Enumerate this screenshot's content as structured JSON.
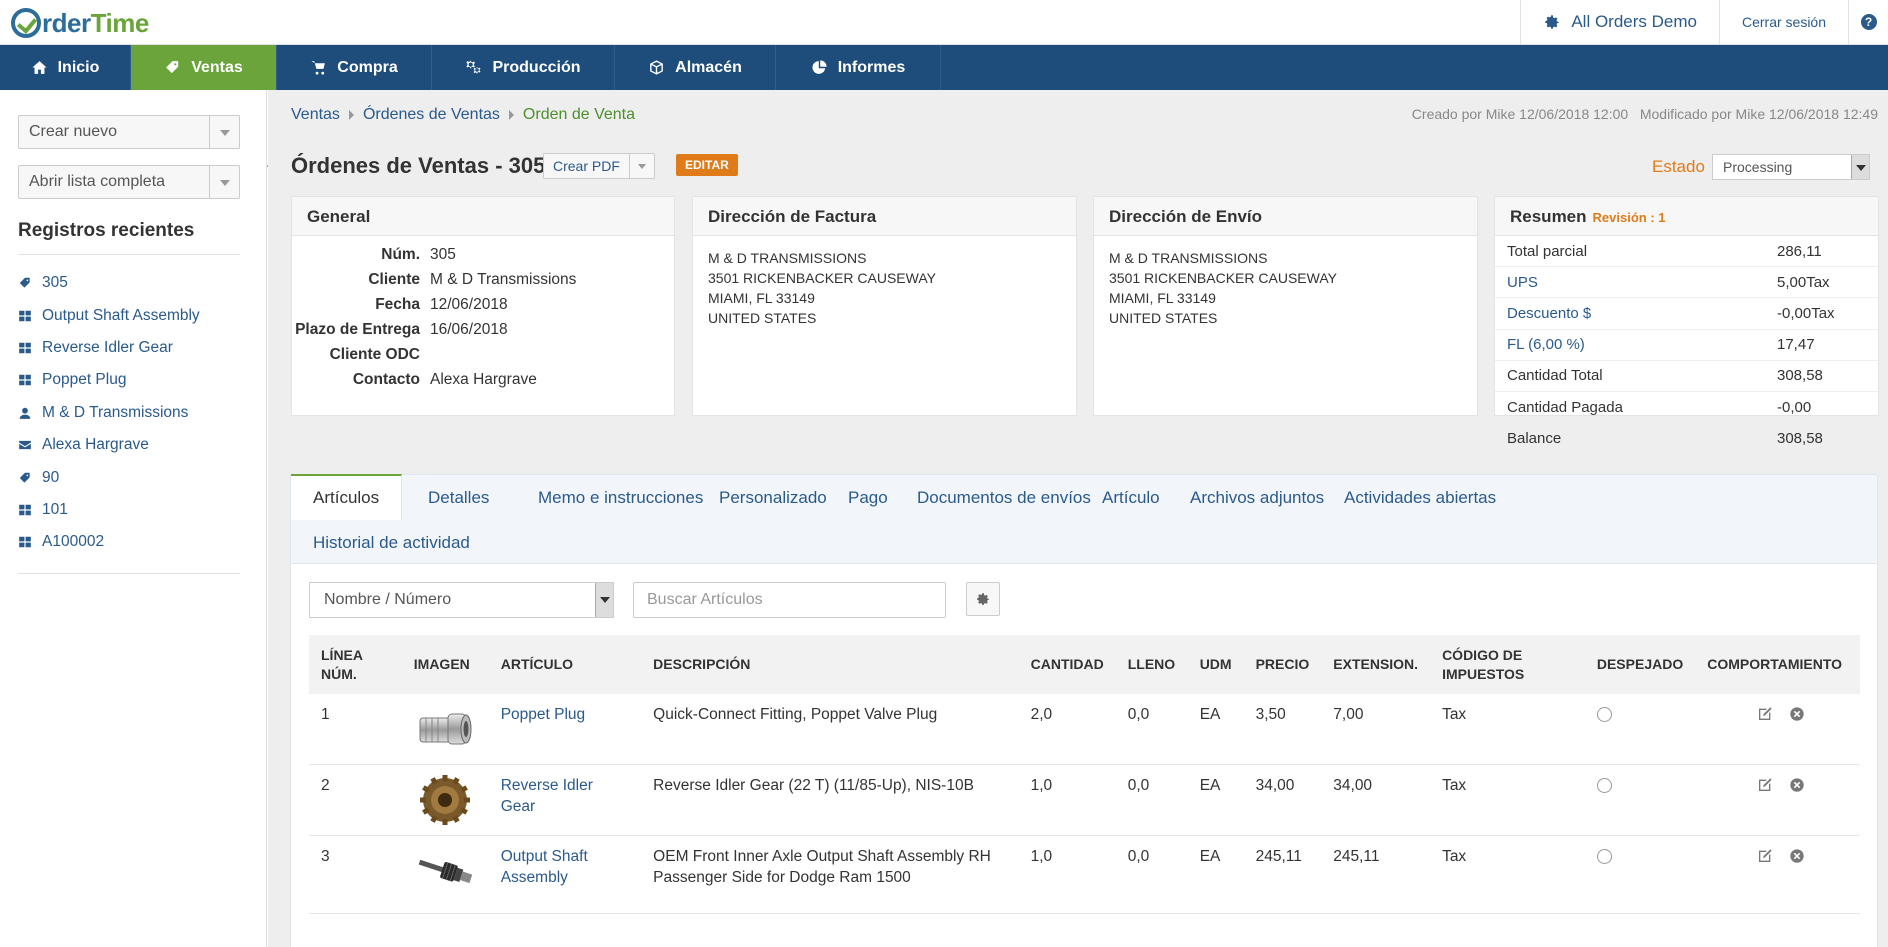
{
  "app": {
    "logo_text_a": "rder",
    "logo_text_b": "Time",
    "company": "All Orders Demo",
    "logout": "Cerrar sesión",
    "help": "?"
  },
  "nav": [
    {
      "label": "Inicio",
      "icon": "home-icon"
    },
    {
      "label": "Ventas",
      "icon": "tag-icon",
      "active": true
    },
    {
      "label": "Compra",
      "icon": "cart-icon"
    },
    {
      "label": "Producción",
      "icon": "gears-icon"
    },
    {
      "label": "Almacén",
      "icon": "box-icon"
    },
    {
      "label": "Informes",
      "icon": "pie-chart-icon"
    }
  ],
  "sidebar": {
    "create_new": "Crear nuevo",
    "open_list": "Abrir lista completa",
    "recent_title": "Registros recientes",
    "recent": [
      {
        "label": "305",
        "icon": "tag-icon"
      },
      {
        "label": "Output Shaft Assembly",
        "icon": "grid-icon"
      },
      {
        "label": "Reverse Idler Gear",
        "icon": "grid-icon"
      },
      {
        "label": "Poppet Plug",
        "icon": "grid-icon"
      },
      {
        "label": "M & D Transmissions",
        "icon": "user-icon"
      },
      {
        "label": "Alexa Hargrave",
        "icon": "envelope-icon"
      },
      {
        "label": "90",
        "icon": "tag-icon"
      },
      {
        "label": "101",
        "icon": "grid-icon"
      },
      {
        "label": "A100002",
        "icon": "grid-icon"
      }
    ]
  },
  "breadcrumb": [
    "Ventas",
    "Órdenes de Ventas",
    "Orden de Venta"
  ],
  "meta": "Creado por Mike 12/06/2018 12:00   Modificado por Mike 12/06/2018 12:49",
  "header": {
    "title": "Órdenes de Ventas - 305",
    "pdf": "Crear PDF",
    "edit": "EDITAR",
    "estado_label": "Estado",
    "estado_value": "Processing"
  },
  "general": {
    "title": "General",
    "rows": [
      {
        "k": "Núm.",
        "v": "305",
        "link": false
      },
      {
        "k": "Cliente",
        "v": "M & D Transmissions",
        "link": true
      },
      {
        "k": "Fecha",
        "v": "12/06/2018",
        "link": false
      },
      {
        "k": "Plazo de Entrega",
        "v": "16/06/2018",
        "link": false
      },
      {
        "k": "Cliente ODC",
        "v": "",
        "link": false
      },
      {
        "k": "Contacto",
        "v": "Alexa Hargrave",
        "link": true
      }
    ]
  },
  "billing": {
    "title": "Dirección de Factura",
    "lines": [
      "M & D TRANSMISSIONS",
      "3501 RICKENBACKER CAUSEWAY",
      "MIAMI, FL 33149",
      "UNITED STATES"
    ]
  },
  "shipping": {
    "title": "Dirección de Envío",
    "lines": [
      "M & D TRANSMISSIONS",
      "3501 RICKENBACKER CAUSEWAY",
      "MIAMI, FL 33149",
      "UNITED STATES"
    ]
  },
  "summary": {
    "title": "Resumen",
    "revision": "Revisión : 1",
    "rows": [
      {
        "k": "Total parcial",
        "v": "286,11",
        "link": false
      },
      {
        "k": "UPS",
        "v": "5,00Tax",
        "link": true
      },
      {
        "k": "Descuento $",
        "v": "-0,00Tax",
        "link": true
      },
      {
        "k": "FL (6,00 %)",
        "v": "17,47",
        "link": true
      },
      {
        "k": "Cantidad Total",
        "v": "308,58",
        "link": false
      },
      {
        "k": "Cantidad Pagada",
        "v": "-0,00",
        "link": false
      },
      {
        "k": "Balance",
        "v": "308,58",
        "link": false
      }
    ]
  },
  "tabs": [
    {
      "label": "Artículos",
      "active": true
    },
    {
      "label": "Detalles"
    },
    {
      "label": "Memo e instrucciones"
    },
    {
      "label": "Personalizado"
    },
    {
      "label": "Pago"
    },
    {
      "label": "Documentos de envíos"
    },
    {
      "label": "Artículo"
    },
    {
      "label": "Archivos adjuntos"
    },
    {
      "label": "Actividades abiertas"
    },
    {
      "label": "Historial de actividad"
    }
  ],
  "items": {
    "filter": "Nombre / Número",
    "search_placeholder": "Buscar Artículos",
    "columns": [
      "LÍNEA NÚM.",
      "IMAGEN",
      "ARTÍCULO",
      "DESCRIPCIÓN",
      "CANTIDAD",
      "LLENO",
      "UDM",
      "PRECIO",
      "EXTENSION.",
      "CÓDIGO DE IMPUESTOS",
      "DESPEJADO",
      "COMPORTAMIENTO"
    ],
    "rows": [
      {
        "line": "1",
        "image": "poppet-plug-image",
        "item": "Poppet Plug",
        "desc": "Quick-Connect Fitting, Poppet Valve Plug",
        "qty": "2,0",
        "filled": "0,0",
        "uom": "EA",
        "price": "3,50",
        "ext": "7,00",
        "tax": "Tax"
      },
      {
        "line": "2",
        "image": "gear-image",
        "item": "Reverse Idler Gear",
        "desc": "Reverse Idler Gear (22 T) (11/85-Up), NIS-10B",
        "qty": "1,0",
        "filled": "0,0",
        "uom": "EA",
        "price": "34,00",
        "ext": "34,00",
        "tax": "Tax"
      },
      {
        "line": "3",
        "image": "shaft-image",
        "item": "Output Shaft Assembly",
        "desc": "OEM Front Inner Axle Output Shaft Assembly RH Passenger Side for Dodge Ram 1500",
        "qty": "1,0",
        "filled": "0,0",
        "uom": "EA",
        "price": "245,11",
        "ext": "245,11",
        "tax": "Tax"
      }
    ]
  }
}
